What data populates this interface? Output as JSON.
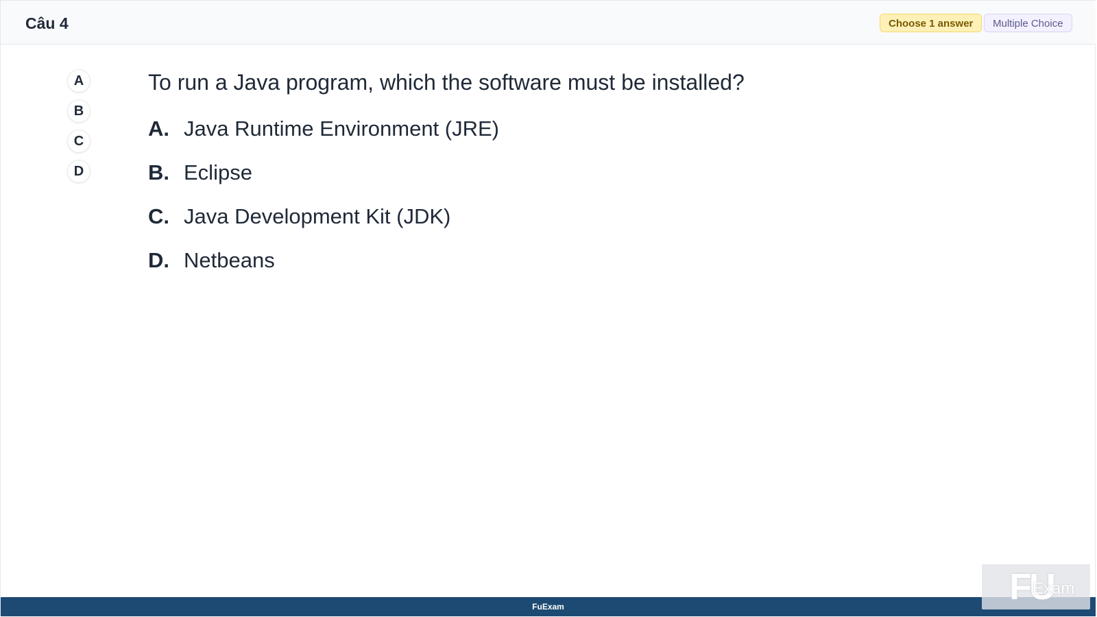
{
  "header": {
    "title": "Câu 4",
    "choose_badge": "Choose 1 answer",
    "type_badge": "Multiple Choice"
  },
  "side_options": [
    "A",
    "B",
    "C",
    "D"
  ],
  "question": {
    "text": "To run a Java program, which the software must be installed?",
    "answers": [
      {
        "letter": "A.",
        "text": "Java Runtime Environment (JRE)"
      },
      {
        "letter": "B.",
        "text": "Eclipse"
      },
      {
        "letter": "C.",
        "text": "Java Development Kit (JDK)"
      },
      {
        "letter": "D.",
        "text": "Netbeans"
      }
    ]
  },
  "footer": {
    "brand": "FuExam"
  },
  "watermark": {
    "logo_fu": "FU",
    "logo_exam": "Exam"
  }
}
